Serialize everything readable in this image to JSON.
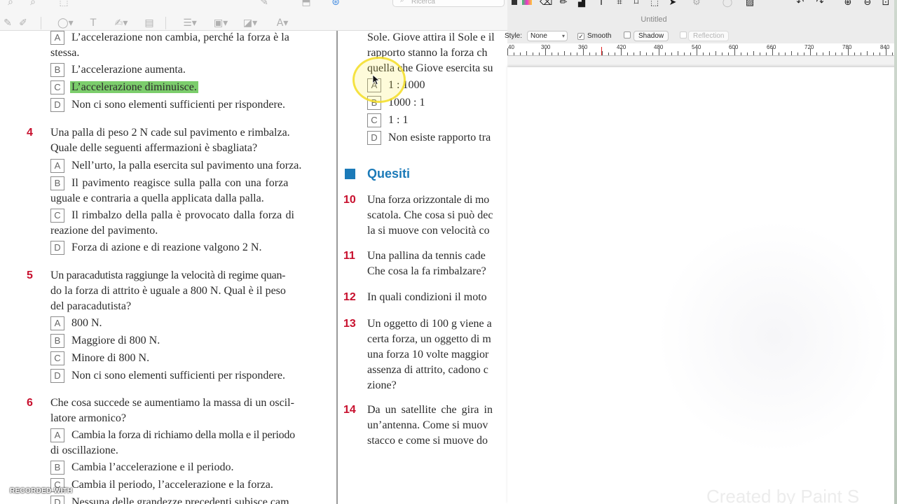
{
  "pdf_toolbar": {
    "search_placeholder": "Ricerca"
  },
  "left_column": {
    "q3_options": [
      {
        "letter": "A",
        "lines": [
          "L’accelerazione non cambia, perché la forza è la",
          "stessa."
        ]
      },
      {
        "letter": "B",
        "lines": [
          "L’accelerazione aumenta."
        ]
      },
      {
        "letter": "C",
        "lines": [
          "L’accelerazione diminuisce."
        ],
        "highlighted": true
      },
      {
        "letter": "D",
        "lines": [
          "Non ci sono elementi sufficienti per rispondere."
        ]
      }
    ],
    "q4": {
      "number": "4",
      "lines": [
        "Una palla di peso 2 N cade sul pavimento e rimbalza.",
        "Quale delle seguenti affermazioni è sbagliata?"
      ],
      "options": [
        {
          "letter": "A",
          "lines": [
            "Nell’urto, la palla esercita sul pavimento una forza."
          ]
        },
        {
          "letter": "B",
          "lines": [
            "Il pavimento reagisce sulla palla con una forza",
            "uguale e contraria a quella applicata dalla palla."
          ]
        },
        {
          "letter": "C",
          "lines": [
            "Il rimbalzo della palla è provocato dalla forza di",
            "reazione del pavimento."
          ]
        },
        {
          "letter": "D",
          "lines": [
            "Forza di azione e di reazione valgono 2 N."
          ]
        }
      ]
    },
    "q5": {
      "number": "5",
      "lines": [
        "Un paracadutista raggiunge la velocità di regime quan-",
        "do la forza di attrito è uguale a 800 N. Qual è il peso",
        "del paracadutista?"
      ],
      "options": [
        {
          "letter": "A",
          "lines": [
            "800 N."
          ]
        },
        {
          "letter": "B",
          "lines": [
            "Maggiore di 800 N."
          ]
        },
        {
          "letter": "C",
          "lines": [
            "Minore di 800 N."
          ]
        },
        {
          "letter": "D",
          "lines": [
            "Non ci sono elementi sufficienti per rispondere."
          ]
        }
      ]
    },
    "q6": {
      "number": "6",
      "lines": [
        "Che cosa succede se aumentiamo la massa di un oscil-",
        "latore armonico?"
      ],
      "options": [
        {
          "letter": "A",
          "lines": [
            "Cambia la forza di richiamo della molla e il periodo",
            "di oscillazione."
          ]
        },
        {
          "letter": "B",
          "lines": [
            "Cambia l’accelerazione e il periodo."
          ]
        },
        {
          "letter": "C",
          "lines": [
            "Cambia il periodo, l’accelerazione e la forza."
          ]
        },
        {
          "letter": "D",
          "lines": [
            "Nessuna delle grandezze precedenti subisce cam"
          ]
        }
      ]
    }
  },
  "right_column": {
    "intro_lines": [
      "Sole. Giove attira il Sole e il",
      "rapporto stanno la forza ch",
      "quella che Giove esercita su"
    ],
    "q9_options": [
      {
        "letter": "A",
        "text": "1 : 1000"
      },
      {
        "letter": "B",
        "text": "1000 : 1"
      },
      {
        "letter": "C",
        "text": "1 : 1"
      },
      {
        "letter": "D",
        "text": "Non esiste rapporto tra"
      }
    ],
    "section_title": "Quesiti",
    "questions": [
      {
        "number": "10",
        "lines": [
          "Una forza orizzontale di mo",
          "scatola. Che cosa si può dec",
          "la si muove con velocità co"
        ]
      },
      {
        "number": "11",
        "lines": [
          "Una pallina da tennis cade",
          "Che cosa la fa rimbalzare?"
        ]
      },
      {
        "number": "12",
        "lines": [
          "In quali condizioni il moto"
        ]
      },
      {
        "number": "13",
        "lines": [
          "Un oggetto di 100 g viene a",
          "certa forza, un oggetto di m",
          "una forza 10 volte maggior",
          "assenza di attrito, cadono c",
          "zione?"
        ]
      },
      {
        "number": "14",
        "lines": [
          "Da un satellite che gira in",
          "un’antenna. Come si muov",
          "stacco e come si muove do"
        ]
      }
    ]
  },
  "recording": {
    "label": "RECORDED WITH"
  },
  "paint": {
    "title": "Untitled",
    "style_label": "Style:",
    "style_value": "None",
    "smooth_label": "Smooth",
    "smooth_checked": true,
    "shadow_label": "Shadow",
    "reflection_label": "Reflection",
    "ruler_labels": [
      "40",
      "300",
      "360",
      "420",
      "480",
      "540",
      "600",
      "660",
      "720",
      "780",
      "840"
    ],
    "watermark": "Created by Paint S",
    "colors": {
      "accent_red": "#c8102e",
      "section_blue": "#1b7ab8",
      "highlight_green": "#7ccd6c"
    },
    "toolbar_icons": [
      "color-swatch-icon",
      "eraser-icon",
      "pencil-icon",
      "bucket-icon",
      "text-icon",
      "transform-icon",
      "crop-icon",
      "select-icon",
      "pointer-icon",
      "gear-icon",
      "image-icon",
      "undo-icon",
      "redo-icon",
      "zoom-in-icon",
      "zoom-out-icon"
    ]
  }
}
